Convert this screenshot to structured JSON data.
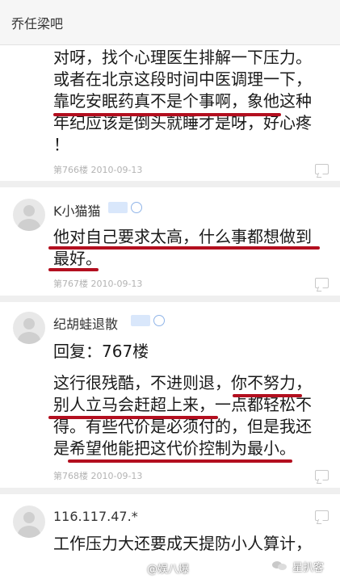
{
  "header": {
    "title": "乔任梁吧"
  },
  "posts": [
    {
      "lines": [
        "对呀，找个心理医生排解一下压力。",
        "或者在北京这段时间中医调理一下，",
        "靠吃安眠药真不是个事啊，象他这种",
        "年纪应该是倒头就睡才是呀，好心疼",
        "！"
      ],
      "meta": "第766楼  2010-09-13"
    },
    {
      "username": "K小猫猫",
      "lines": [
        "他对自己要求太高，什么事都想做到",
        "最好。"
      ],
      "meta": "第767楼  2010-09-13"
    },
    {
      "username": "纪胡蛙退散",
      "reply": "回复：767楼",
      "lines": [
        "这行很残酷，不进则退，你不努力，",
        "别人立马会赶超上来，一点都轻松不",
        "得。有些代价是必须付的，但是我还",
        "是希望他能把这代价控制为最小。"
      ],
      "meta": "第768楼  2010-09-13"
    },
    {
      "username": "116.117.47.*",
      "lines": [
        "工作压力大还要成天提防小人算计，"
      ]
    }
  ],
  "watermarks": {
    "left": "@娱八爆",
    "right": "星扒客"
  },
  "colors": {
    "underline": "#b30f1f",
    "background": "#ffffff",
    "header_bg": "#f6f6f6"
  }
}
